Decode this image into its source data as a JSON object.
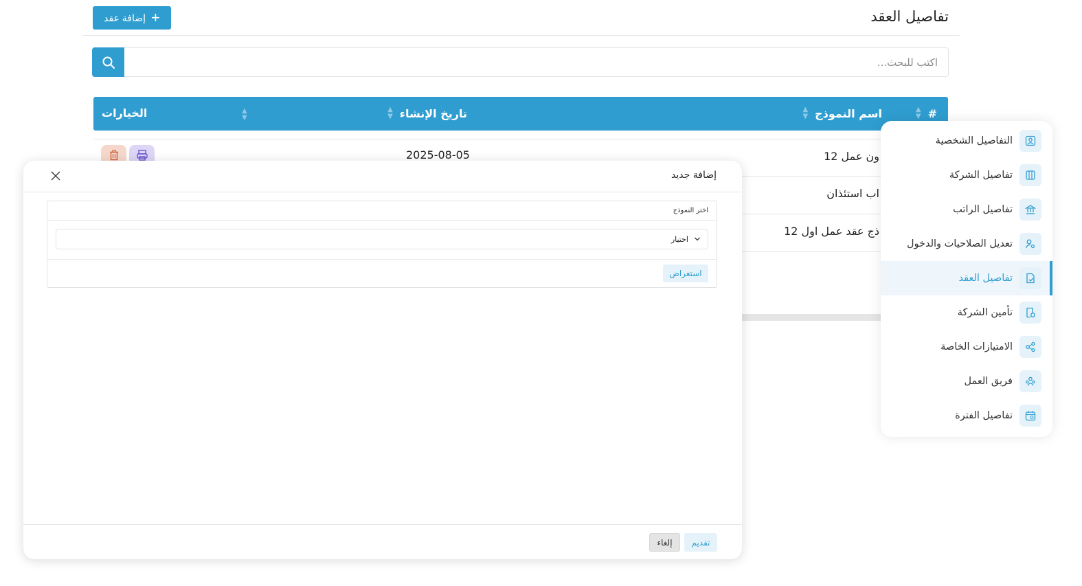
{
  "header": {
    "title": "تفاصيل العقد",
    "add_button_label": "إضافة عقد"
  },
  "search": {
    "placeholder": "اكتب للبحث..."
  },
  "table": {
    "columns": [
      "#",
      "اسم النموذج",
      "تاريخ الإنشاء",
      "الخيارات"
    ],
    "rows": [
      {
        "name": "ون عمل 12",
        "date": "2025-08-05"
      },
      {
        "name": "اب استئذان",
        "date": ""
      },
      {
        "name": "ذج عقد عمل اول 12",
        "date": ""
      }
    ]
  },
  "sidebar": {
    "items": [
      {
        "label": "التفاصيل الشخصية",
        "icon": "user-icon"
      },
      {
        "label": "تفاصيل الشركة",
        "icon": "building-icon"
      },
      {
        "label": "تفاصيل الراتب",
        "icon": "bank-icon"
      },
      {
        "label": "تعديل الصلاحيات والدخول",
        "icon": "user-key-icon"
      },
      {
        "label": "تفاصيل العقد",
        "icon": "contract-icon",
        "active": true
      },
      {
        "label": "تأمين الشركة",
        "icon": "insurance-icon"
      },
      {
        "label": "الامتيازات الخاصة",
        "icon": "share-icon"
      },
      {
        "label": "فريق العمل",
        "icon": "team-icon"
      },
      {
        "label": "تفاصيل الفترة",
        "icon": "calendar-icon"
      }
    ]
  },
  "modal": {
    "title": "إضافة جديد",
    "template_label": "اختر النموذج",
    "select_value": "اختيار",
    "preview_label": "استعراض",
    "submit_label": "تقديم",
    "cancel_label": "إلغاء"
  },
  "colors": {
    "primary": "#2f9dd0",
    "delete_bg": "#f6d7cc",
    "print_bg": "#ddd6f6"
  }
}
